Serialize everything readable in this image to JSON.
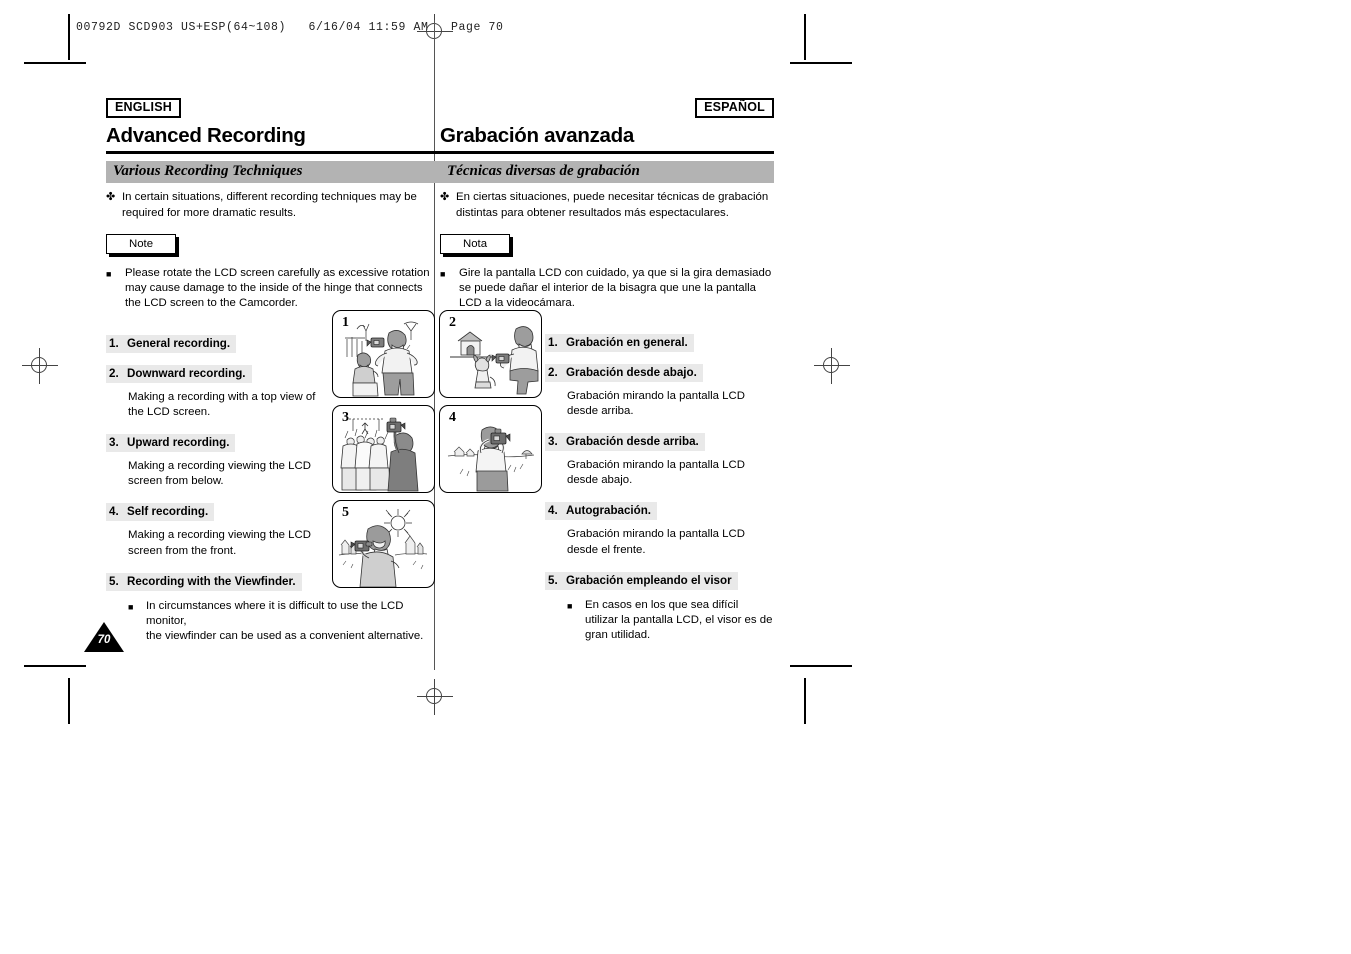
{
  "print_slug": "00792D SCD903 US+ESP(64~108)   6/16/04 11:59 AM   Page 70",
  "page_number": "70",
  "colors": {
    "section_bar": "#b3b3b3",
    "heading_highlight": "#e9e9e9",
    "text": "#000000",
    "rule": "#000000"
  },
  "icons": {
    "flower_bullet": "✤",
    "square_bullet": "■"
  },
  "english": {
    "lang_tag": "ENGLISH",
    "chapter_title": "Advanced Recording",
    "section_title": "Various Recording Techniques",
    "intro": "In certain situations, different recording techniques may be required for more dramatic results.",
    "note_label": "Note",
    "note_text": "Please rotate the LCD screen carefully as excessive rotation may cause damage to the inside of the hinge that connects the LCD screen to the Camcorder.",
    "items": [
      {
        "index": "1.",
        "heading": "General recording.",
        "description": "",
        "sub_bullet": ""
      },
      {
        "index": "2.",
        "heading": "Downward recording.",
        "description": "Making a recording with a top view of the LCD screen.",
        "sub_bullet": ""
      },
      {
        "index": "3.",
        "heading": "Upward recording.",
        "description": "Making a recording viewing the LCD screen from below.",
        "sub_bullet": ""
      },
      {
        "index": "4.",
        "heading": "Self recording.",
        "description": "Making a recording viewing the LCD screen from the front.",
        "sub_bullet": ""
      },
      {
        "index": "5.",
        "heading": "Recording with the Viewfinder.",
        "description": "",
        "sub_bullet": "In circumstances where it is difficult to use the LCD monitor,\nthe viewfinder can be used as a convenient alternative."
      }
    ]
  },
  "spanish": {
    "lang_tag": "ESPAÑOL",
    "chapter_title": "Grabación avanzada",
    "section_title": "Técnicas diversas de grabación",
    "intro": "En ciertas situaciones, puede necesitar técnicas de grabación distintas para obtener resultados más espectaculares.",
    "note_label": "Nota",
    "note_text": "Gire la pantalla LCD con cuidado, ya que si la gira demasiado se puede dañar el interior de la bisagra que une la pantalla LCD a la videocámara.",
    "items": [
      {
        "index": "1.",
        "heading": "Grabación en general.",
        "description": "",
        "sub_bullet": ""
      },
      {
        "index": "2.",
        "heading": "Grabación desde abajo.",
        "description": "Grabación mirando la pantalla LCD desde arriba.",
        "sub_bullet": ""
      },
      {
        "index": "3.",
        "heading": "Grabación desde arriba.",
        "description": "Grabación mirando la pantalla LCD desde abajo.",
        "sub_bullet": ""
      },
      {
        "index": "4.",
        "heading": "Autograbación.",
        "description": "Grabación mirando la pantalla LCD desde el frente.",
        "sub_bullet": ""
      },
      {
        "index": "5.",
        "heading": "Grabación empleando el visor",
        "description": "",
        "sub_bullet": "En casos en los que sea difícil utilizar la pantalla LCD, el visor es de gran utilidad."
      }
    ]
  },
  "figures": [
    {
      "number": "1",
      "caption": "two people filming with camcorder outdoors"
    },
    {
      "number": "2",
      "caption": "person crouching filming a dog downward"
    },
    {
      "number": "3",
      "caption": "person filming over a crowd upward"
    },
    {
      "number": "4",
      "caption": "person filming landscape holding camcorder up"
    },
    {
      "number": "5",
      "caption": "person self recording with viewfinder under the sun"
    }
  ]
}
